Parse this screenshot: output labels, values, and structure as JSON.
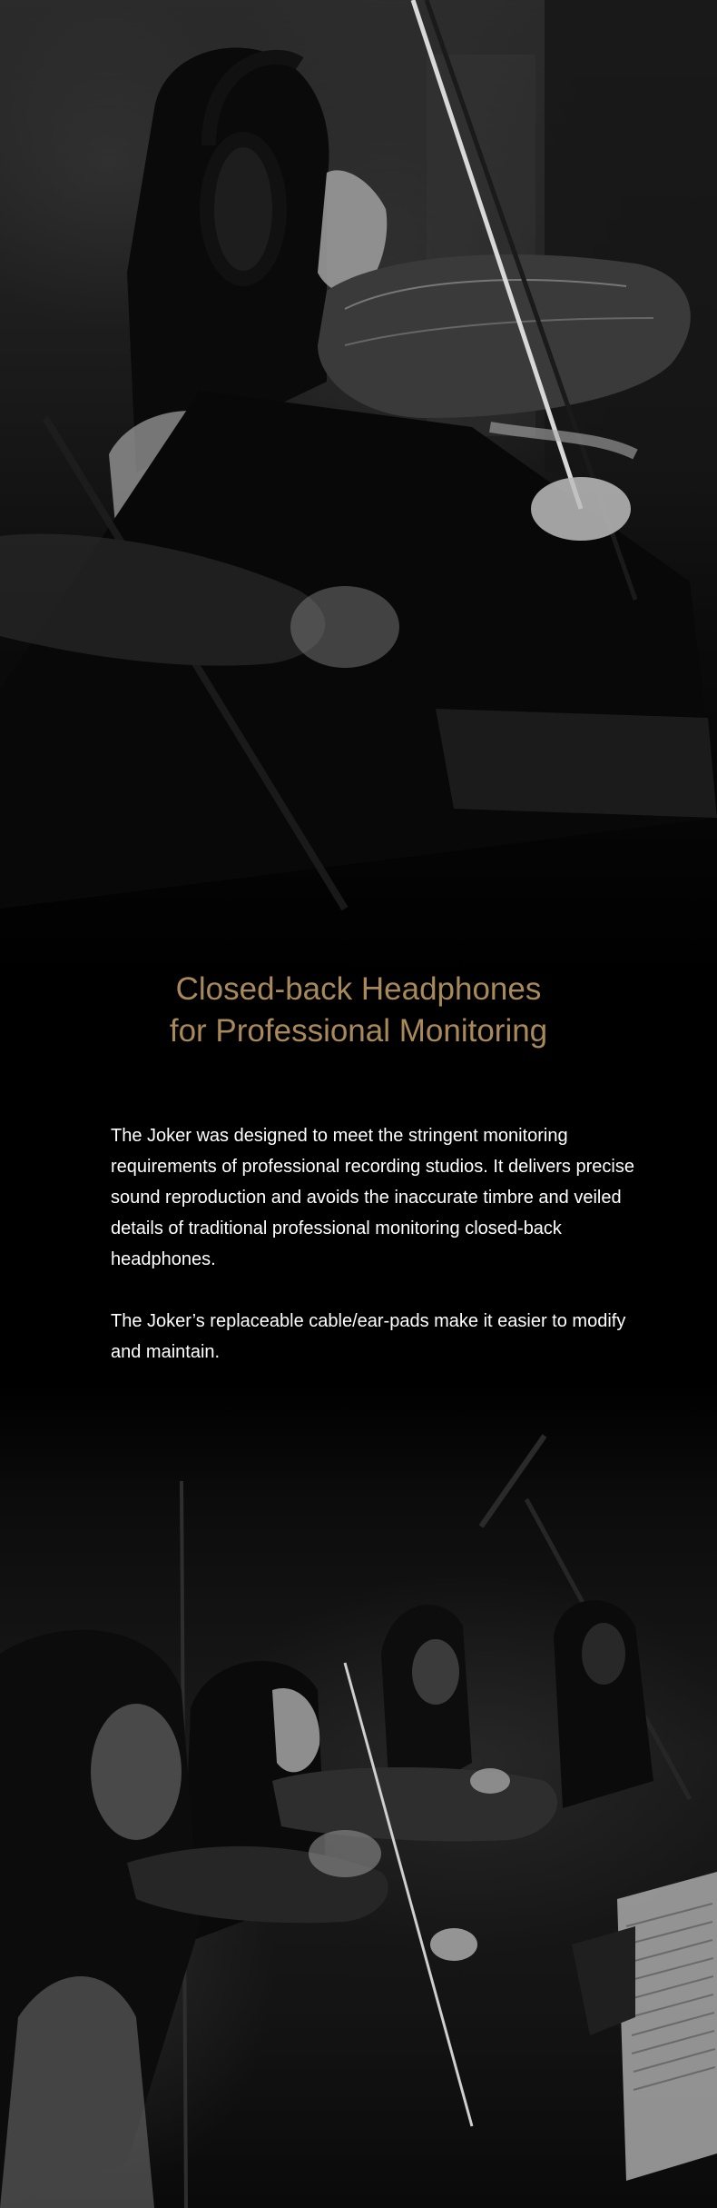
{
  "headline": {
    "line1": "Closed-back Headphones",
    "line2": "for Professional Monitoring"
  },
  "description": {
    "paragraph1": "The Joker was designed to meet the stringent monitoring requirements of professional recording studios. It delivers precise sound reproduction and avoids the inaccurate timbre and veiled details of traditional professional monitoring closed-back headphones.",
    "paragraph2": "The Joker’s replaceable cable/ear-pads make it easier to modify and maintain."
  },
  "colors": {
    "background": "#000000",
    "headline": "#a8895a",
    "body_text": "#ffffff"
  }
}
